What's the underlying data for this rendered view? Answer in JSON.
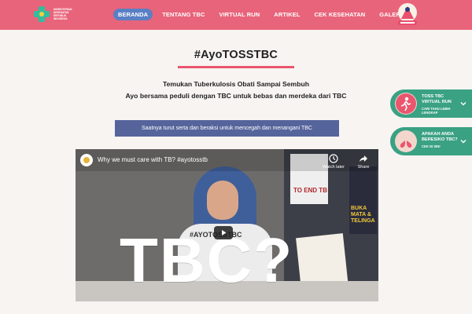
{
  "brand": {
    "logo_text": "KEMENTERIAN KESEHATAN REPUBLIK INDONESIA",
    "accent_color": "#e8647a",
    "nav_active_color": "#5a7fc4",
    "side_widget_color": "#3aa183"
  },
  "nav": {
    "items": [
      {
        "label": "BERANDA",
        "active": true
      },
      {
        "label": "TENTANG TBC",
        "active": false
      },
      {
        "label": "VIRTUAL RUN",
        "active": false
      },
      {
        "label": "ARTIKEL",
        "active": false
      },
      {
        "label": "CEK KESEHATAN",
        "active": false
      },
      {
        "label": "GALERI",
        "active": false
      }
    ]
  },
  "main": {
    "hashtag": "#AyoTOSSTBC",
    "tagline_1": "Temukan Tuberkulosis Obati Sampai Sembuh",
    "tagline_2": "Ayo bersama peduli dengan TBC untuk bebas dan merdeka dari TBC",
    "cta": "Saatnya turut serta dan beraksi untuk mencegah dan menangani TBC"
  },
  "video": {
    "title": "Why we must care with TB? #ayotosstb",
    "watch_later": "Watch later",
    "share": "Share",
    "overlay_text": "TBC?",
    "shirt_text": "#AYOTOSSTBC",
    "poster_1": "TO END TB",
    "poster_2": "BUKA MATA & TELINGA"
  },
  "side_widgets": [
    {
      "title": "TOSS TBC VIRTUAL RUN",
      "subtitle": "CARI TAHU LEBIH LENGKAP",
      "icon": "runner-icon"
    },
    {
      "title": "APAKAH ANDA BERESIKO TBC?",
      "subtitle": "CEK DI SINI",
      "icon": "lungs-icon"
    }
  ]
}
